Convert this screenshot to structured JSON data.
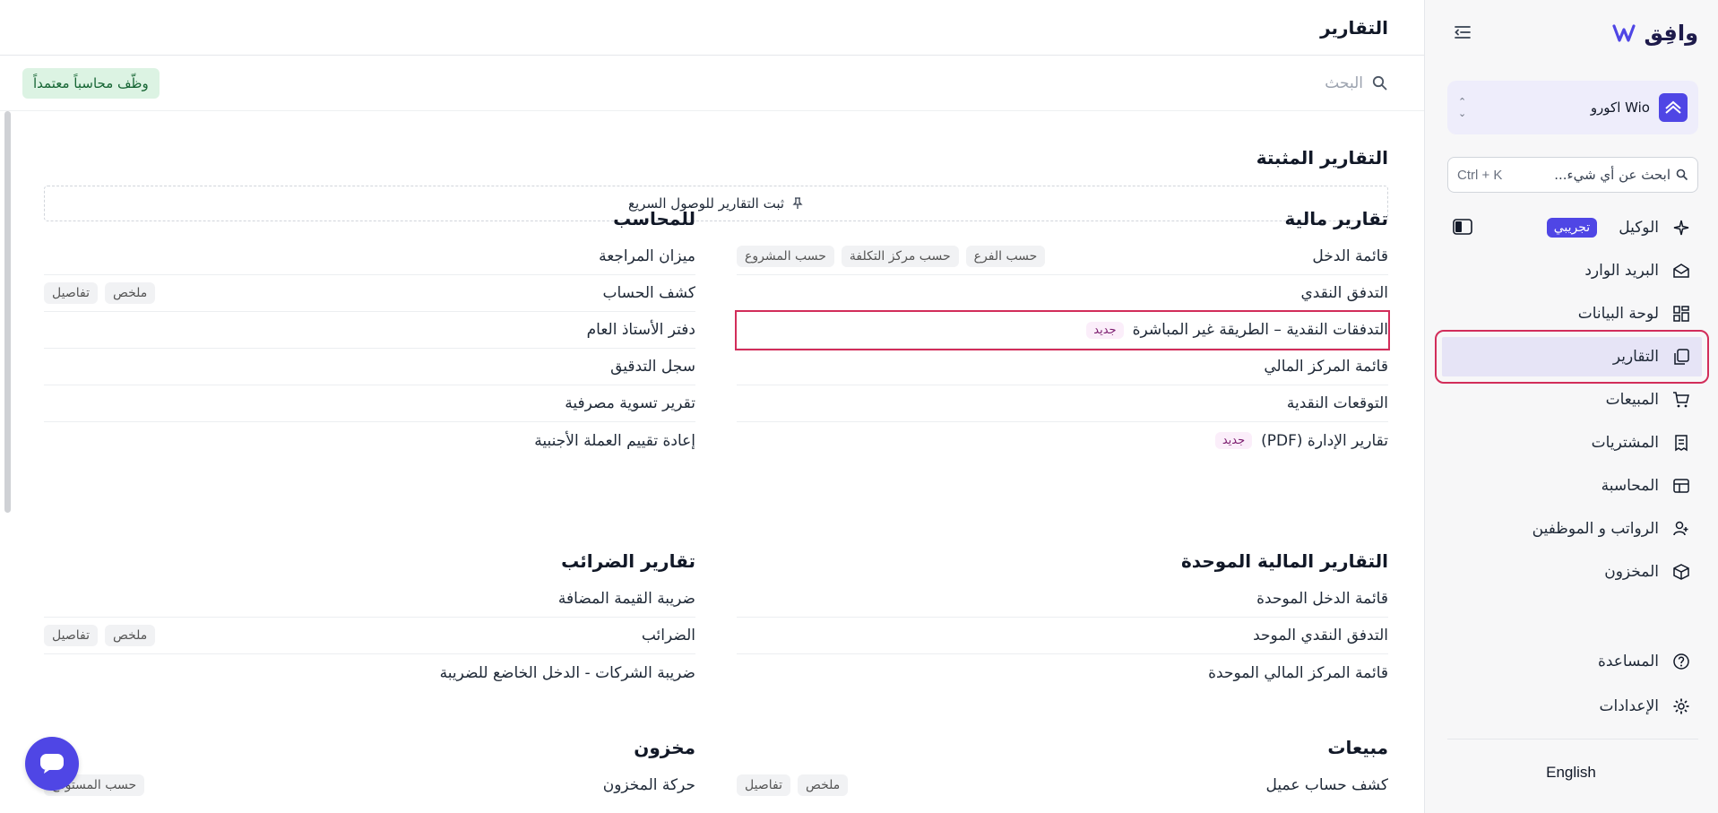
{
  "brand": {
    "name": "وافِق",
    "accent": "#4f46e5",
    "highlight": "#d22d5a"
  },
  "org": {
    "name": "Wio اكورو"
  },
  "global_search": {
    "placeholder": "ابحث عن أي شيء...",
    "shortcut": "Ctrl + K"
  },
  "nav": {
    "items": [
      {
        "label": "الوكيل",
        "icon": "sparkles-icon",
        "badge": "تجريبي"
      },
      {
        "label": "البريد الوارد",
        "icon": "envelope-icon"
      },
      {
        "label": "لوحة البيانات",
        "icon": "dashboard-icon"
      },
      {
        "label": "التقارير",
        "icon": "reports-icon",
        "active": true
      },
      {
        "label": "المبيعات",
        "icon": "cart-icon"
      },
      {
        "label": "المشتريات",
        "icon": "receipt-icon"
      },
      {
        "label": "المحاسبة",
        "icon": "ledger-icon"
      },
      {
        "label": "الرواتب و الموظفين",
        "icon": "users-icon"
      },
      {
        "label": "المخزون",
        "icon": "box-icon"
      }
    ],
    "help": "المساعدة",
    "settings": "الإعدادات",
    "language": "English"
  },
  "page": {
    "title": "التقارير",
    "search_placeholder": "البحث",
    "hire_button": "وظّف محاسباً معتمداً",
    "pinned_title": "التقارير المثبتة",
    "pin_hint": "ثبت التقارير للوصول السريع"
  },
  "sections": {
    "financial": {
      "title": "تقارير مالية",
      "rows": [
        {
          "name": "قائمة الدخل",
          "tags": [
            "حسب الفرع",
            "حسب مركز التكلفة",
            "حسب المشروع"
          ]
        },
        {
          "name": "التدفق النقدي",
          "tags": []
        },
        {
          "name": "التدفقات النقدية – الطريقة غير المباشرة",
          "new": "جديد",
          "tags": []
        },
        {
          "name": "قائمة المركز المالي",
          "tags": []
        },
        {
          "name": "التوقعات النقدية",
          "tags": []
        },
        {
          "name": "تقارير الإدارة (PDF)",
          "new": "جديد",
          "tags": []
        }
      ]
    },
    "accountant": {
      "title": "للمحاسب",
      "rows": [
        {
          "name": "ميزان المراجعة",
          "tags": []
        },
        {
          "name": "كشف الحساب",
          "tags": [
            "ملخص",
            "تفاصيل"
          ]
        },
        {
          "name": "دفتر الأستاذ العام",
          "tags": []
        },
        {
          "name": "سجل التدقيق",
          "tags": []
        },
        {
          "name": "تقرير تسوية مصرفية",
          "tags": []
        },
        {
          "name": "إعادة تقييم العملة الأجنبية",
          "tags": []
        }
      ]
    },
    "consolidated": {
      "title": "التقارير المالية الموحدة",
      "rows": [
        {
          "name": "قائمة الدخل الموحدة",
          "tags": []
        },
        {
          "name": "التدفق النقدي الموحد",
          "tags": []
        },
        {
          "name": "قائمة المركز المالي الموحدة",
          "tags": []
        }
      ]
    },
    "tax": {
      "title": "تقارير الضرائب",
      "rows": [
        {
          "name": "ضريبة القيمة المضافة",
          "tags": []
        },
        {
          "name": "الضرائب",
          "tags": [
            "ملخص",
            "تفاصيل"
          ]
        },
        {
          "name": "ضريبة الشركات - الدخل الخاضع للضريبة",
          "tags": []
        }
      ]
    },
    "sales": {
      "title": "مبيعات",
      "rows": [
        {
          "name": "كشف حساب عميل",
          "tags": [
            "ملخص",
            "تفاصيل"
          ]
        }
      ]
    },
    "inventory": {
      "title": "مخزون",
      "rows": [
        {
          "name": "حركة المخزون",
          "tags": [
            "حسب المستودع"
          ]
        }
      ]
    }
  }
}
